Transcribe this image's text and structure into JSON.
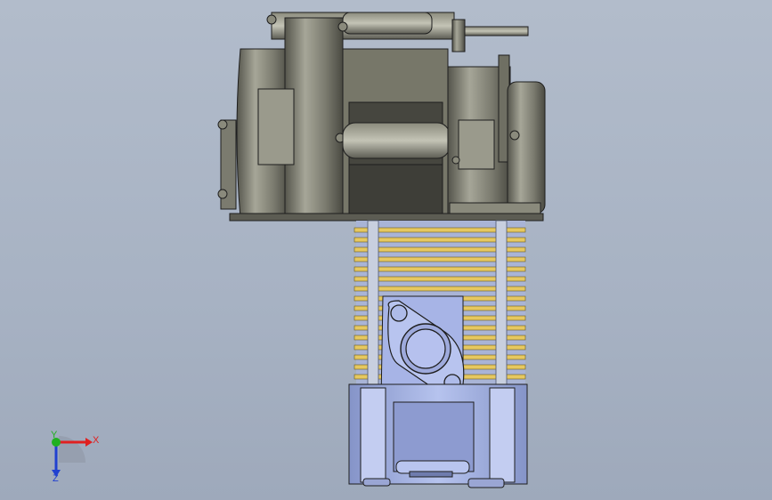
{
  "viewport": {
    "background_top": "#b2bccb",
    "background_bottom": "#9ea9bb"
  },
  "model": {
    "description_icon": "engine-assembly",
    "colors": {
      "gearbox_metal": "#6f6f63",
      "gearbox_light": "#9a9a8c",
      "gearbox_dark": "#46463f",
      "cylinder_fins": "#e6c860",
      "cylinder_body": "#a8b6e4",
      "cylinder_shadow": "#7d8cc0",
      "outline": "#1e1e1e"
    }
  },
  "triad": {
    "x_label": "X",
    "y_label": "Y",
    "z_label": "Z",
    "x_color": "#e02020",
    "y_color": "#20b020",
    "z_color": "#2040d0"
  }
}
